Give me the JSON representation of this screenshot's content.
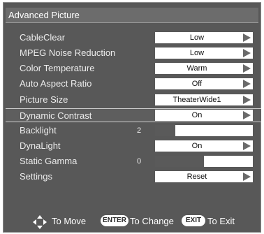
{
  "title": "Advanced Picture",
  "rows": [
    {
      "label": "CableClear",
      "value": "Low"
    },
    {
      "label": "MPEG Noise Reduction",
      "value": "Low"
    },
    {
      "label": "Color Temperature",
      "value": "Warm"
    },
    {
      "label": "Auto Aspect Ratio",
      "value": "Off"
    },
    {
      "label": "Picture Size",
      "value": "TheaterWide1"
    },
    {
      "label": "Dynamic Contrast",
      "value": "On"
    },
    {
      "label": "Backlight",
      "number": "2",
      "level": 0.21
    },
    {
      "label": "DynaLight",
      "value": "On"
    },
    {
      "label": "Static Gamma",
      "number": "0",
      "level": 0.5
    },
    {
      "label": "Settings",
      "value": "Reset"
    }
  ],
  "selected_row": "Dynamic Contrast",
  "footer": {
    "move_text": "To Move",
    "enter_key": "ENTER",
    "change_text": "To Change",
    "exit_key": "EXIT",
    "exit_text": "To Exit"
  },
  "colors": {
    "panel": "#585858",
    "text": "#ececec",
    "value_box": "#ffffff",
    "slider_fill": "#5a5a5a"
  }
}
